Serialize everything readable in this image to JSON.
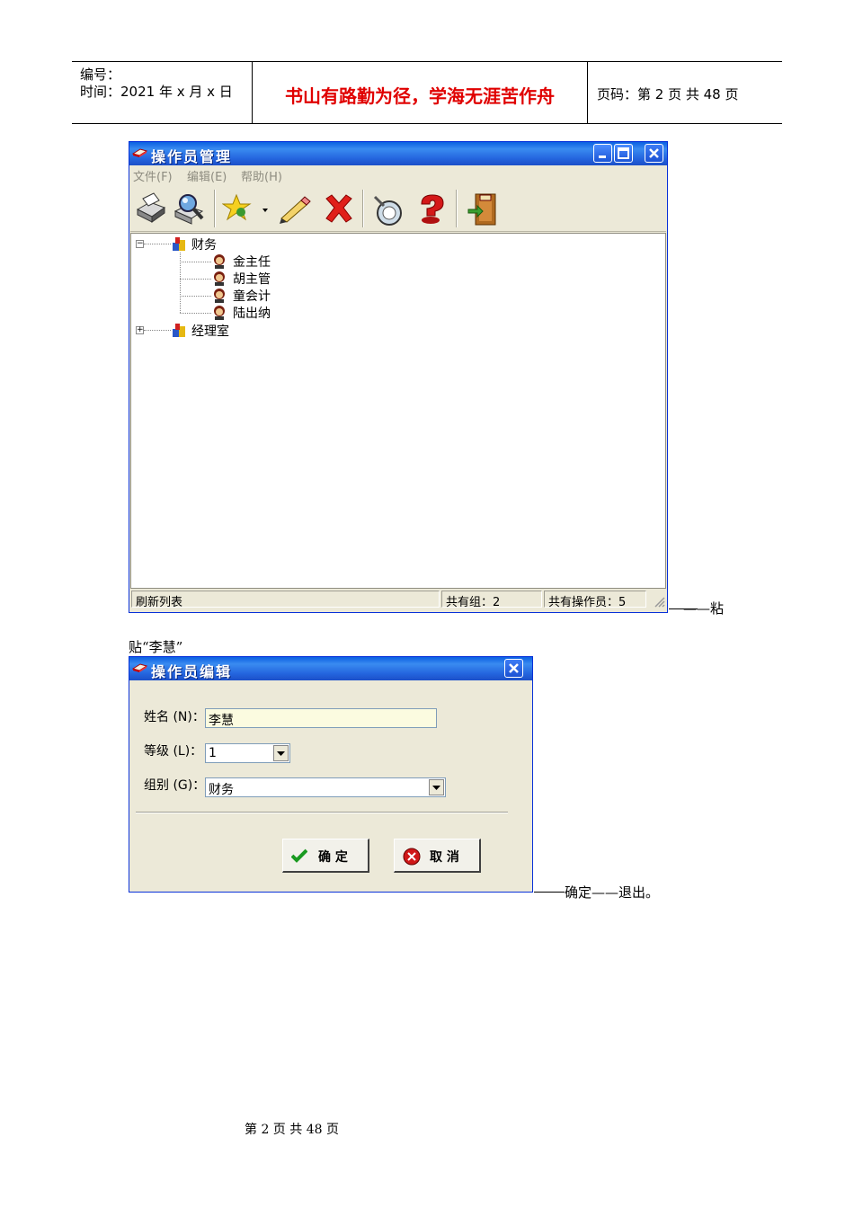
{
  "header": {
    "number_label": "编号：",
    "time_label": "时间：2021 年 x 月 x 日",
    "motto": "书山有路勤为径，学海无涯苦作舟",
    "page_info": "页码：第 2 页  共 48 页"
  },
  "window1": {
    "title": "操作员管理",
    "menu": [
      "文件(F)",
      "编辑(E)",
      "帮助(H)"
    ],
    "toolbar_icons": [
      "print-icon",
      "search-icon",
      "add-icon",
      "edit-icon",
      "delete-icon",
      "locate-icon",
      "help-icon",
      "exit-icon"
    ],
    "tree": {
      "group1": "财务",
      "members": [
        "金主任",
        "胡主管",
        "童会计",
        "陆出纳"
      ],
      "group2": "经理室"
    },
    "status": {
      "left": "刷新列表",
      "groups": "共有组：2",
      "operators": "共有操作员：5"
    }
  },
  "annotation1_suffix": "——粘",
  "annotation1_line2": "贴“李慧”",
  "window2": {
    "title": "操作员编辑",
    "name_label": "姓名 (N)：",
    "name_value": "李慧",
    "level_label": "等级 (L)：",
    "level_value": "1",
    "group_label": "组别 (G)：",
    "group_value": "财务",
    "ok_label": "确 定",
    "cancel_label": "取 消"
  },
  "annotation2": "确定——退出。",
  "footer": "第 2 页 共 48 页",
  "colors": {
    "motto": "#e00000",
    "title_bar": "#2466df",
    "name_field_bg": "#fbfbe0"
  }
}
